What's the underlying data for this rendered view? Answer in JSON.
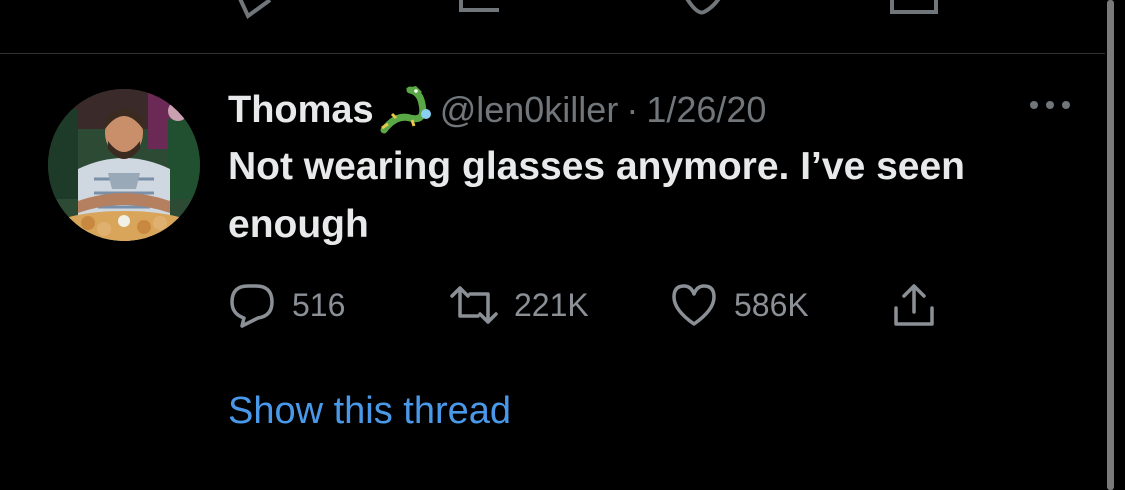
{
  "tweet": {
    "display_name": "Thomas",
    "handle": "@len0killer",
    "separator": "·",
    "date": "1/26/20",
    "text": "Not wearing glasses anymore. I’ve seen enough",
    "emoji": "dragon-icon"
  },
  "actions": {
    "reply_count": "516",
    "retweet_count": "221K",
    "like_count": "586K"
  },
  "show_thread_label": "Show this thread",
  "colors": {
    "background": "#000000",
    "primary_text": "#e7e9ea",
    "secondary_text": "#71767b",
    "link": "#4a99e9",
    "divider": "#2f3336"
  }
}
